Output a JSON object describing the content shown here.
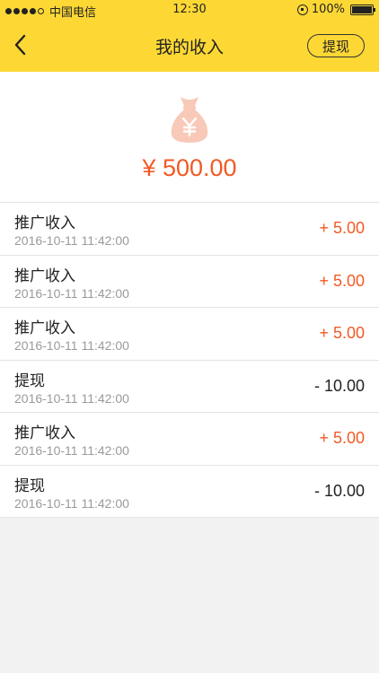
{
  "status_bar": {
    "carrier": "中国电信",
    "time": "12:30",
    "battery": "100%",
    "signal_bars": 4,
    "icons": [
      "signal-icon",
      "orientation-lock-icon",
      "battery-icon"
    ]
  },
  "nav": {
    "title": "我的收入",
    "back_icon": "chevron-left-icon",
    "action_label": "提现"
  },
  "summary": {
    "icon": "moneybag-yen-icon",
    "balance": "¥ 500.00"
  },
  "records": [
    {
      "title": "推广收入",
      "time": "2016-10-11 11:42:00",
      "amount": "+ 5.00",
      "type": "income"
    },
    {
      "title": "推广收入",
      "time": "2016-10-11 11:42:00",
      "amount": "+ 5.00",
      "type": "income"
    },
    {
      "title": "推广收入",
      "time": "2016-10-11 11:42:00",
      "amount": "+ 5.00",
      "type": "income"
    },
    {
      "title": "提现",
      "time": "2016-10-11 11:42:00",
      "amount": "- 10.00",
      "type": "expense"
    },
    {
      "title": "推广收入",
      "time": "2016-10-11 11:42:00",
      "amount": "+ 5.00",
      "type": "income"
    },
    {
      "title": "提现",
      "time": "2016-10-11 11:42:00",
      "amount": "- 10.00",
      "type": "expense"
    }
  ],
  "colors": {
    "header_bg": "#fdd835",
    "income": "#f15a24",
    "expense": "#222222",
    "icon_tint": "#f8c9b8"
  }
}
